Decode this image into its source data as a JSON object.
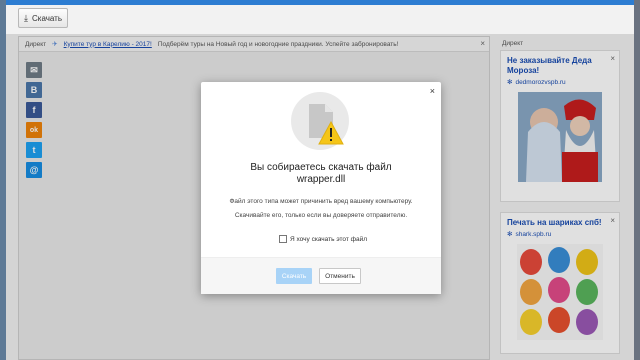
{
  "toolbar": {
    "download_label": "Скачать",
    "download_icon": "download-icon"
  },
  "ad_bar": {
    "label": "Директ",
    "link_text": "Купите тур в Карелию - 2017!",
    "rest_text": "Подберём туры на Новый год и новогодние праздники. Успейте забронировать!",
    "close": "×"
  },
  "social": [
    {
      "name": "mail",
      "glyph": "✉",
      "color": "#6f7c86"
    },
    {
      "name": "vk",
      "glyph": "B",
      "color": "#4a76a8"
    },
    {
      "name": "facebook",
      "glyph": "f",
      "color": "#3b5998"
    },
    {
      "name": "odnoklassniki",
      "glyph": "ok",
      "color": "#ee8208"
    },
    {
      "name": "twitter",
      "glyph": "t",
      "color": "#1da1f2"
    },
    {
      "name": "moimir",
      "glyph": "@",
      "color": "#168de2"
    }
  ],
  "sidebar": {
    "label": "Директ",
    "ads": [
      {
        "title": "Не заказывайте Деда Мороза!",
        "domain": "dedmorozvspb.ru",
        "close": "×"
      },
      {
        "title": "Печать на шариках спб!",
        "domain": "shark.spb.ru",
        "close": "×"
      }
    ]
  },
  "dialog": {
    "close": "×",
    "title_line1": "Вы собираетесь скачать файл",
    "title_line2": "wrapper.dll",
    "message1": "Файл этого типа может причинить вред вашему компьютеру.",
    "message2": "Скачивайте его, только если вы доверяете отправителю.",
    "checkbox_label": "Я хочу скачать этот файл",
    "download_button": "Скачать",
    "cancel_button": "Отменить"
  },
  "colors": {
    "accent": "#2d7dd2",
    "link": "#1a4db3",
    "warning": "#f5c518"
  }
}
